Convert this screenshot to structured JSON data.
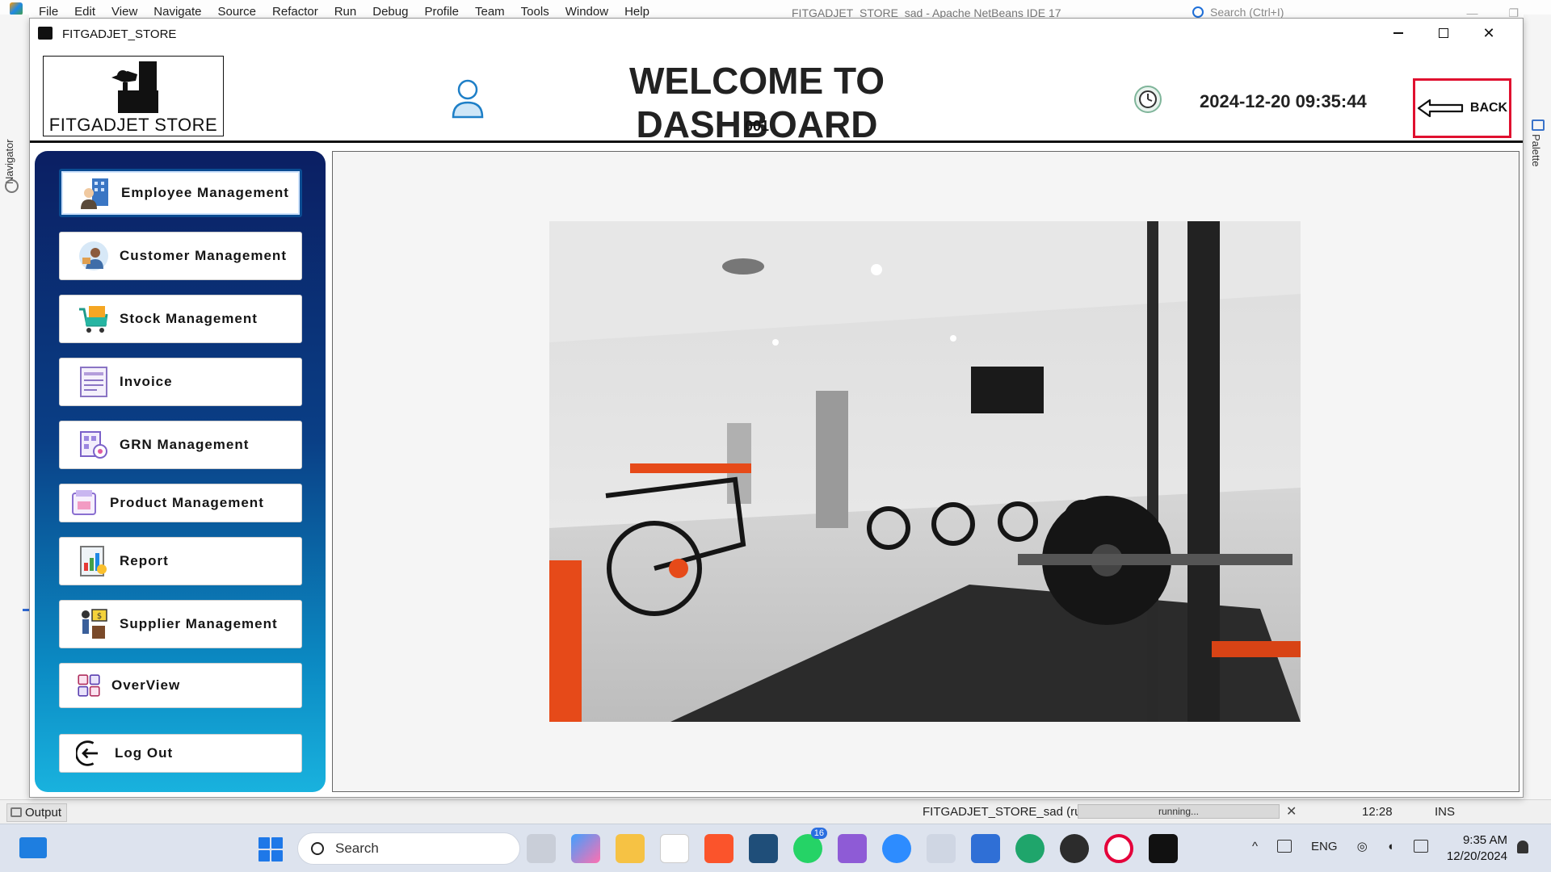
{
  "ide": {
    "menus": [
      "File",
      "Edit",
      "View",
      "Navigate",
      "Source",
      "Refactor",
      "Run",
      "Debug",
      "Profile",
      "Team",
      "Tools",
      "Window",
      "Help"
    ],
    "title": "FITGADJET_STORE_sad - Apache NetBeans IDE 17",
    "search_placeholder": "Search (Ctrl+I)",
    "left_panel_label": "Navigator",
    "right_panel_label": "Palette",
    "output_tab": "Output",
    "run_label": "FITGADJET_STORE_sad (run)",
    "run_status": "running...",
    "caret_position": "12:28",
    "insert_mode": "INS"
  },
  "app": {
    "window_title": "FITGADJET_STORE",
    "logo_text": "FITGADJET STORE",
    "dashboard_title": "WELCOME TO DASHBOARD",
    "user_id": "001",
    "datetime": "2024-12-20 09:35:44",
    "back_label": "BACK"
  },
  "sidebar": {
    "items": [
      {
        "label": "Employee Management",
        "icon": "employee-icon"
      },
      {
        "label": "Customer Management",
        "icon": "customer-icon"
      },
      {
        "label": "Stock Management",
        "icon": "cart-icon"
      },
      {
        "label": "Invoice",
        "icon": "invoice-icon"
      },
      {
        "label": "GRN Management",
        "icon": "grn-icon"
      },
      {
        "label": "Product Management",
        "icon": "product-icon"
      },
      {
        "label": "Report",
        "icon": "report-icon"
      },
      {
        "label": "Supplier Management",
        "icon": "supplier-icon"
      },
      {
        "label": "OverView",
        "icon": "overview-icon"
      },
      {
        "label": "Log Out",
        "icon": "logout-icon"
      }
    ]
  },
  "taskbar": {
    "search_label": "Search",
    "whatsapp_badge": "16",
    "language": "ENG",
    "time": "9:35 AM",
    "date": "12/20/2024"
  }
}
